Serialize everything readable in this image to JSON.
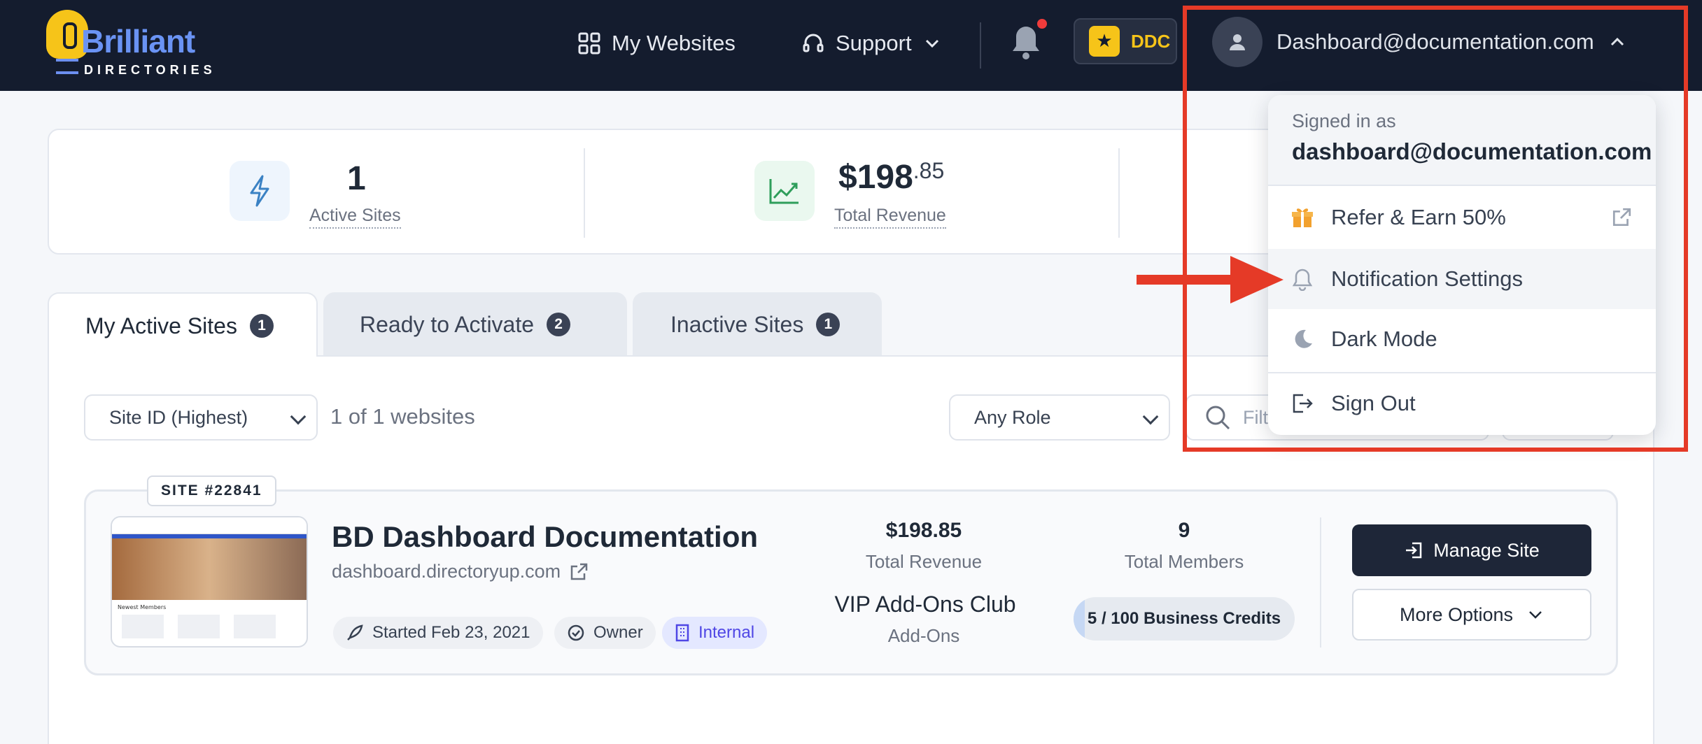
{
  "header": {
    "logo_word": "Brilliant",
    "logo_sub": "DIRECTORIES",
    "nav": [
      {
        "label": "My Websites",
        "icon": "grid-icon"
      },
      {
        "label": "Support",
        "icon": "headset-icon"
      }
    ],
    "ddc_label": "DDC",
    "user_email": "Dashboard@documentation.com"
  },
  "stats": [
    {
      "value": "1",
      "label": "Active Sites",
      "icon": "bolt-icon"
    },
    {
      "value": "$198",
      "cents": ".85",
      "label": "Total Revenue",
      "icon": "trend-icon"
    }
  ],
  "tabs": [
    {
      "label": "My Active Sites",
      "count": "1"
    },
    {
      "label": "Ready to Activate",
      "count": "2"
    },
    {
      "label": "Inactive Sites",
      "count": "1"
    }
  ],
  "filters": {
    "sort": "Site ID (Highest)",
    "count_text": "1 of 1 websites",
    "role": "Any Role",
    "search_placeholder": "Filter"
  },
  "site": {
    "tag": "SITE #22841",
    "title": "BD Dashboard Documentation",
    "domain": "dashboard.directoryup.com",
    "chips": [
      "Started Feb 23, 2021",
      "Owner",
      "Internal"
    ],
    "revenue_value": "$198.85",
    "revenue_label": "Total Revenue",
    "members_value": "9",
    "members_label": "Total Members",
    "addons_value": "VIP Add-Ons Club",
    "addons_label": "Add-Ons",
    "credits_text": "5 / 100 Business Credits",
    "credits_fraction": 0.05,
    "manage_label": "Manage Site",
    "more_label": "More Options"
  },
  "dropdown": {
    "signed_in_label": "Signed in as",
    "email": "dashboard@documentation.com",
    "items": [
      {
        "label": "Refer & Earn 50%",
        "icon": "gift-icon"
      },
      {
        "label": "Notification Settings",
        "icon": "bell-icon"
      },
      {
        "label": "Dark Mode",
        "icon": "moon-icon"
      },
      {
        "label": "Sign Out",
        "icon": "sign-out-icon"
      }
    ]
  },
  "colors": {
    "annotation": "#e53a27",
    "header_bg": "#141c2e",
    "accent": "#f6c419"
  }
}
